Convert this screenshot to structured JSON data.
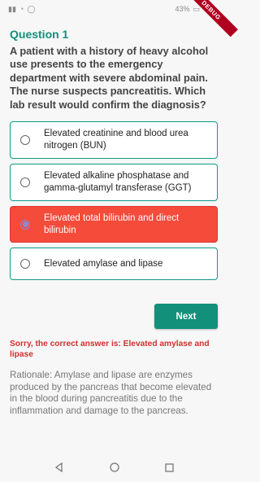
{
  "status_bar": {
    "left_icons": [
      "signal-icon",
      "wifi-icon",
      "whatsapp-icon"
    ],
    "battery_text": "43%",
    "debug_label": "DEBUG"
  },
  "question": {
    "title": "Question 1",
    "text": "A patient with a history of heavy alcohol use presents to the emergency department with severe abdominal pain. The nurse suspects pancreatitis. Which lab result would confirm the diagnosis?"
  },
  "options": [
    {
      "label": "Elevated creatinine and blood urea nitrogen (BUN)",
      "selected": false
    },
    {
      "label": "Elevated alkaline phosphatase and gamma-glutamyl transferase (GGT)",
      "selected": false
    },
    {
      "label": "Elevated total bilirubin and direct bilirubin",
      "selected": true
    },
    {
      "label": "Elevated amylase and lipase",
      "selected": false
    }
  ],
  "next_label": "Next",
  "feedback": "Sorry, the correct answer is: Elevated amylase and lipase",
  "rationale": "Rationale: Amylase and lipase are enzymes produced by the pancreas that become elevated in the blood during pancreatitis due to the inflammation and damage to the pancreas.",
  "colors": {
    "accent": "#12907a",
    "wrong_selection": "#f54b3a",
    "feedback": "#d32f2f"
  },
  "nav": {
    "back_icon": "back-triangle-icon",
    "home_icon": "home-circle-icon",
    "recents_icon": "recents-square-icon"
  }
}
